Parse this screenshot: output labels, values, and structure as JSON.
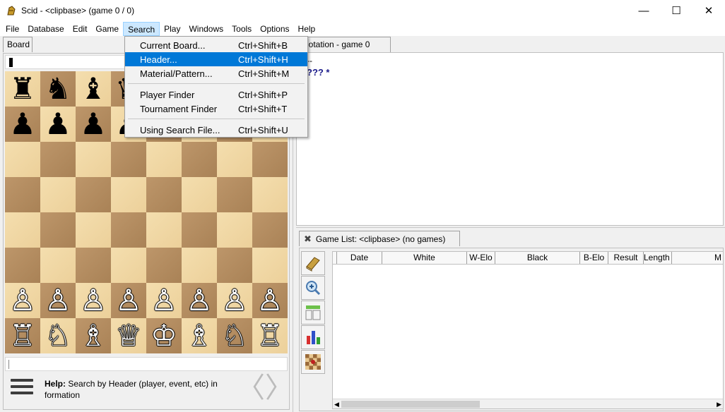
{
  "window": {
    "title": "Scid - <clipbase> (game 0 / 0)",
    "controls": {
      "minimize": "—",
      "maximize": "☐",
      "close": "✕"
    }
  },
  "menubar": {
    "items": [
      "File",
      "Database",
      "Edit",
      "Game",
      "Search",
      "Play",
      "Windows",
      "Tools",
      "Options",
      "Help"
    ],
    "active": "Search"
  },
  "search_menu": {
    "items": [
      {
        "label": "Current Board...",
        "accel": "Ctrl+Shift+B"
      },
      {
        "label": "Header...",
        "accel": "Ctrl+Shift+H",
        "highlighted": true
      },
      {
        "label": "Material/Pattern...",
        "accel": "Ctrl+Shift+M"
      },
      {
        "label": "Player Finder",
        "accel": "Ctrl+Shift+P"
      },
      {
        "label": "Tournament Finder",
        "accel": "Ctrl+Shift+T"
      },
      {
        "label": "Using Search File...",
        "accel": "Ctrl+Shift+U"
      }
    ],
    "highlight_color": "#0078d7"
  },
  "board_panel": {
    "tab_label": "Board",
    "position": [
      [
        "♜",
        "♞",
        "♝",
        "♛",
        "♚",
        "♝",
        "♞",
        "♜"
      ],
      [
        "♟",
        "♟",
        "♟",
        "♟",
        "♟",
        "♟",
        "♟",
        "♟"
      ],
      [
        "",
        "",
        "",
        "",
        "",
        "",
        "",
        ""
      ],
      [
        "",
        "",
        "",
        "",
        "",
        "",
        "",
        ""
      ],
      [
        "",
        "",
        "",
        "",
        "",
        "",
        "",
        ""
      ],
      [
        "",
        "",
        "",
        "",
        "",
        "",
        "",
        ""
      ],
      [
        "♙",
        "♙",
        "♙",
        "♙",
        "♙",
        "♙",
        "♙",
        "♙"
      ],
      [
        "♖",
        "♘",
        "♗",
        "♕",
        "♔",
        "♗",
        "♘",
        "♖"
      ]
    ],
    "help_label": "Help:",
    "help_text": "Search by Header (player, event, etc) in formation",
    "prev_arrow": "〈",
    "next_arrow": "〉"
  },
  "notation_panel": {
    "tab_label": "Notation - game 0",
    "line1": "--",
    "line2": "??? *"
  },
  "gamelist_panel": {
    "tab_label": "Game List: <clipbase> (no games)",
    "close_icon": "✖",
    "toolbar": [
      "book-icon",
      "zoom-in-icon",
      "layout-icon",
      "bar-chart-icon",
      "board-icon"
    ],
    "columns": [
      "",
      "Date",
      "White",
      "W-Elo",
      "Black",
      "B-Elo",
      "Result",
      "Length",
      "M"
    ]
  },
  "colors": {
    "light_square": "#f0d9a8",
    "dark_square": "#b58d62",
    "menu_active_bg": "#cce8ff"
  }
}
